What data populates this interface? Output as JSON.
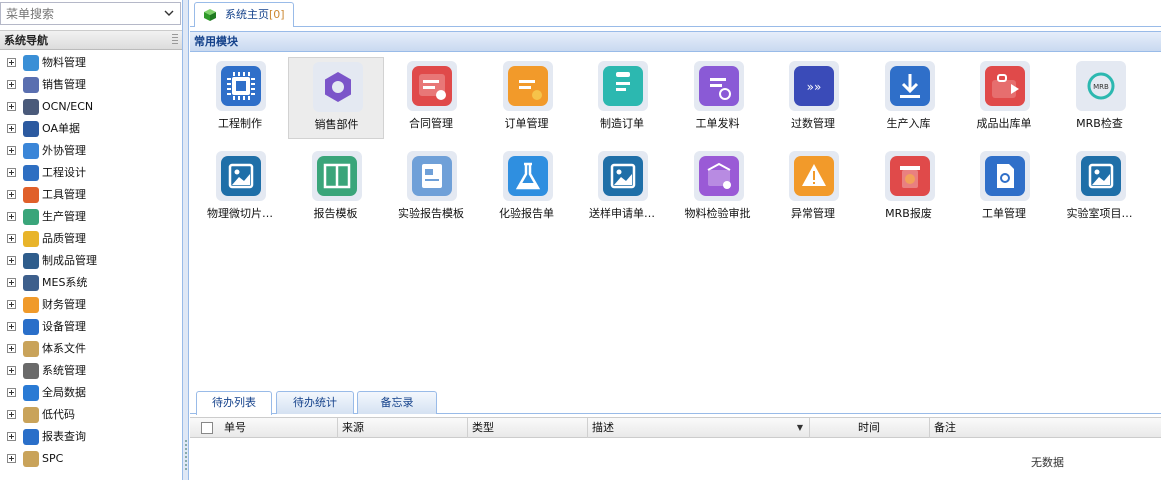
{
  "sidebar": {
    "search_placeholder": "菜单搜索",
    "title": "系统导航",
    "items": [
      {
        "label": "物料管理",
        "icon": "box-icon",
        "color": "#3a8fd6"
      },
      {
        "label": "销售管理",
        "icon": "sales-icon",
        "color": "#5a6fb0"
      },
      {
        "label": "OCN/ECN",
        "icon": "gear-icon",
        "color": "#4a5a7a"
      },
      {
        "label": "OA单据",
        "icon": "document-icon",
        "color": "#2c5aa0"
      },
      {
        "label": "外协管理",
        "icon": "handshake-icon",
        "color": "#3b86d8"
      },
      {
        "label": "工程设计",
        "icon": "design-icon",
        "color": "#2e6fc2"
      },
      {
        "label": "工具管理",
        "icon": "toolbox-icon",
        "color": "#e0602a"
      },
      {
        "label": "生产管理",
        "icon": "production-icon",
        "color": "#3aa57a"
      },
      {
        "label": "品质管理",
        "icon": "quality-icon",
        "color": "#e8b42a"
      },
      {
        "label": "制成品管理",
        "icon": "molecule-icon",
        "color": "#2f5d8c"
      },
      {
        "label": "MES系统",
        "icon": "server-icon",
        "color": "#3d5f8c"
      },
      {
        "label": "财务管理",
        "icon": "finance-icon",
        "color": "#f09a2a"
      },
      {
        "label": "设备管理",
        "icon": "equipment-icon",
        "color": "#2a6fc9"
      },
      {
        "label": "体系文件",
        "icon": "house-icon",
        "color": "#c9a35a"
      },
      {
        "label": "系统管理",
        "icon": "settings-icon",
        "color": "#6a6a6a"
      },
      {
        "label": "全局数据",
        "icon": "pie-chart-icon",
        "color": "#2a7ad4"
      },
      {
        "label": "低代码",
        "icon": "house-icon",
        "color": "#c9a35a"
      },
      {
        "label": "报表查询",
        "icon": "report-search-icon",
        "color": "#2a6fc9"
      },
      {
        "label": "SPC",
        "icon": "house-icon",
        "color": "#c9a35a"
      }
    ]
  },
  "tabs": {
    "home_label": "系统主页",
    "home_count": "[0]"
  },
  "panel": {
    "title": "常用模块",
    "modules": [
      {
        "label": "工程制作",
        "icon": "chip-icon",
        "bg": "#2f6fc9"
      },
      {
        "label": "销售部件",
        "icon": "hexagon-icon",
        "bg": "#7b55c9",
        "selected": true
      },
      {
        "label": "合同管理",
        "icon": "contract-icon",
        "bg": "#e04a4a"
      },
      {
        "label": "订单管理",
        "icon": "order-icon",
        "bg": "#f29a2a"
      },
      {
        "label": "制造订单",
        "icon": "clipboard-icon",
        "bg": "#2cb8b0"
      },
      {
        "label": "工单发料",
        "icon": "material-issue-icon",
        "bg": "#8a5ad6"
      },
      {
        "label": "过数管理",
        "icon": "chevrons-icon",
        "bg": "#3a4bb8"
      },
      {
        "label": "生产入库",
        "icon": "download-icon",
        "bg": "#2f6fc9"
      },
      {
        "label": "成品出库单",
        "icon": "outbound-icon",
        "bg": "#e04a4a"
      },
      {
        "label": "MRB检查",
        "icon": "mrb-check-icon",
        "bg": "#2cb8b0"
      },
      {
        "label": "物理微切片…",
        "icon": "photo-icon",
        "bg": "#1f6fa8"
      },
      {
        "label": "报告模板",
        "icon": "template-icon",
        "bg": "#3aa57a"
      },
      {
        "label": "实验报告模板",
        "icon": "report-doc-icon",
        "bg": "#6fa0d8"
      },
      {
        "label": "化验报告单",
        "icon": "flask-icon",
        "bg": "#2f8fe0"
      },
      {
        "label": "送样申请单…",
        "icon": "photo-icon",
        "bg": "#1f6fa8"
      },
      {
        "label": "物料检验审批",
        "icon": "inspect-box-icon",
        "bg": "#9a5ad6"
      },
      {
        "label": "异常管理",
        "icon": "warning-icon",
        "bg": "#f29a2a"
      },
      {
        "label": "MRB报废",
        "icon": "scrap-bin-icon",
        "bg": "#e04a4a"
      },
      {
        "label": "工单管理",
        "icon": "workorder-icon",
        "bg": "#2f6fc9"
      },
      {
        "label": "实验室项目…",
        "icon": "photo-icon",
        "bg": "#1f6fa8"
      }
    ]
  },
  "bottom": {
    "tabs": [
      {
        "label": "待办列表",
        "active": true
      },
      {
        "label": "待办统计",
        "active": false
      },
      {
        "label": "备忘录",
        "active": false
      }
    ],
    "columns": [
      "单号",
      "来源",
      "类型",
      "描述",
      "时间",
      "备注"
    ],
    "sort_indicator": "▼",
    "empty_text": "无数据"
  }
}
